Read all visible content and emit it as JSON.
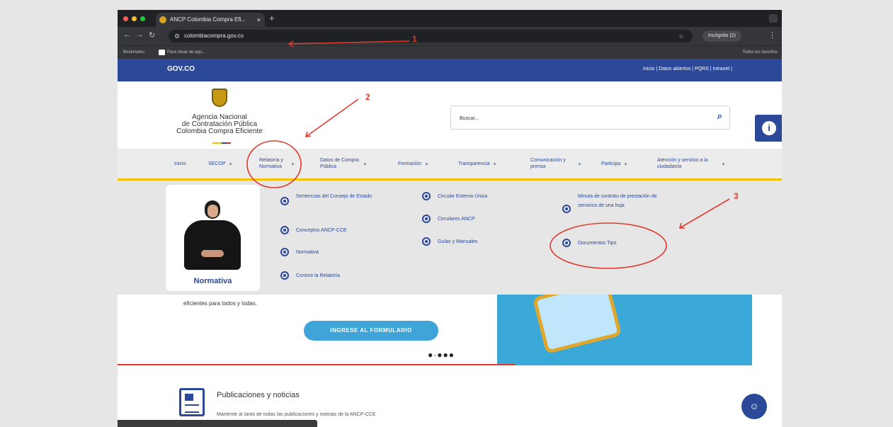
{
  "browser": {
    "tab_title": "ANCP Colombia Compra Efi...",
    "tab_close": "×",
    "new_tab": "+",
    "url": "colombiacompra.gov.co",
    "incognito_label": "Incógnito (2)",
    "bookmarks": {
      "all": "Bookmarks",
      "item": "Para situar de aqu...",
      "all_bookmarks": "Todos los favoritos"
    }
  },
  "govbar": {
    "logo": "GOV.CO",
    "links": "Inicio | Datos abiertos | PQRS | Intranet |"
  },
  "header": {
    "agency_line1": "Agencia Nacional",
    "agency_line2": "de Contratación Pública",
    "agency_line3": "Colombia Compra Eficiente",
    "search_placeholder": "Buscar..."
  },
  "menu": {
    "items": [
      {
        "label": "Inicio",
        "chevron": ""
      },
      {
        "label": "SECOP",
        "chevron": "+"
      },
      {
        "label": "Relatoría y Normativa",
        "chevron": "+"
      },
      {
        "label": "Datos de Compra Pública",
        "chevron": "+"
      },
      {
        "label": "Formación",
        "chevron": "+"
      },
      {
        "label": "Transparencia",
        "chevron": "+"
      },
      {
        "label": "Comunicación y prensa",
        "chevron": "+"
      },
      {
        "label": "Participa",
        "chevron": "+"
      },
      {
        "label": "Atención y servicio a la ciudadanía",
        "chevron": "+"
      }
    ]
  },
  "dropdown": {
    "panel_label": "Normativa",
    "col1": [
      "Sentencias del Consejo de Estado",
      "Conceptos ANCP-CCE",
      "Normativa",
      "Conoce la Relatoría"
    ],
    "col2": [
      "Circular Externa Única",
      "Circulares ANCP",
      "Guías y Manuales"
    ],
    "col3": [
      "Minuta de contrato de prestación de servicios de una hoja",
      "Documentos Tipo"
    ]
  },
  "hero": {
    "text": "eficientes para todos y todas.",
    "cta": "INGRESE AL FORMULARIO",
    "dots": "●·●●●"
  },
  "publications": {
    "title": "Publicaciones y noticias",
    "subtitle": "Mantente al tanto de todas las publicaciones y noticias de la ANCP-CCE"
  },
  "annotations": {
    "n1": "1",
    "n2": "2",
    "n3": "3",
    "color": "#e03a2e"
  },
  "colors": {
    "brand_blue": "#2b4899",
    "gold": "#f3c300",
    "cta_blue": "#3fa4d8"
  }
}
